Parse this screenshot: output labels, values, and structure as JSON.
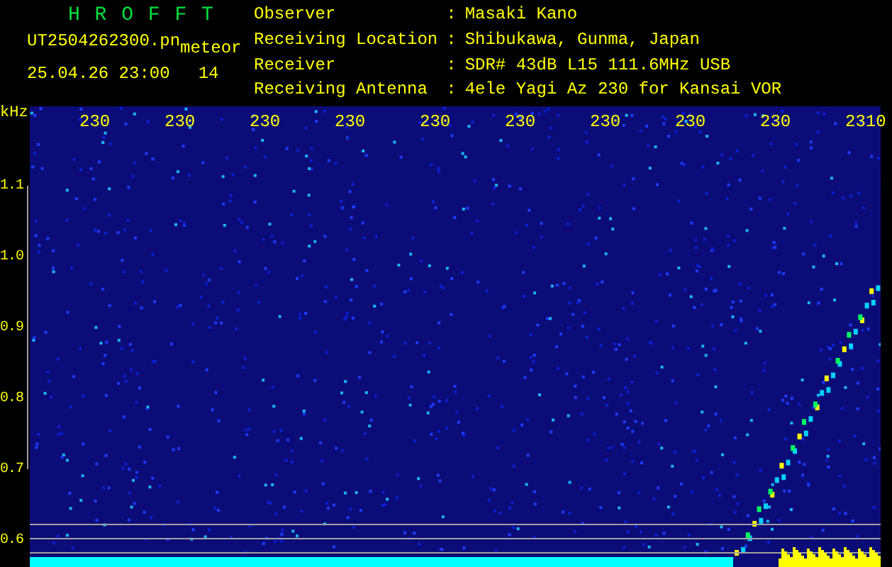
{
  "header": {
    "title": "H R O F F T",
    "file_name": "UT2504262300.pn",
    "mode": "meteor",
    "date_time": "25.04.26 23:00",
    "value": "14"
  },
  "station_info": [
    {
      "label": "Observer",
      "value": "Masaki Kano"
    },
    {
      "label": "Receiving Location",
      "value": "Shibukawa, Gunma, Japan"
    },
    {
      "label": "Receiver",
      "value": "SDR# 43dB L15 111.6MHz USB"
    },
    {
      "label": "Receiving Antenna",
      "value": "4ele Yagi Az 230 for Kansai VOR"
    }
  ],
  "separator": ":",
  "y_axis": {
    "unit": "kHz",
    "labels": [
      "1.1",
      "1.0",
      "0.9",
      "0.8",
      "0.7",
      "0.6"
    ]
  },
  "time_labels": [
    "230",
    "230",
    "230",
    "230",
    "230",
    "230",
    "230",
    "230",
    "230",
    "2310"
  ]
}
